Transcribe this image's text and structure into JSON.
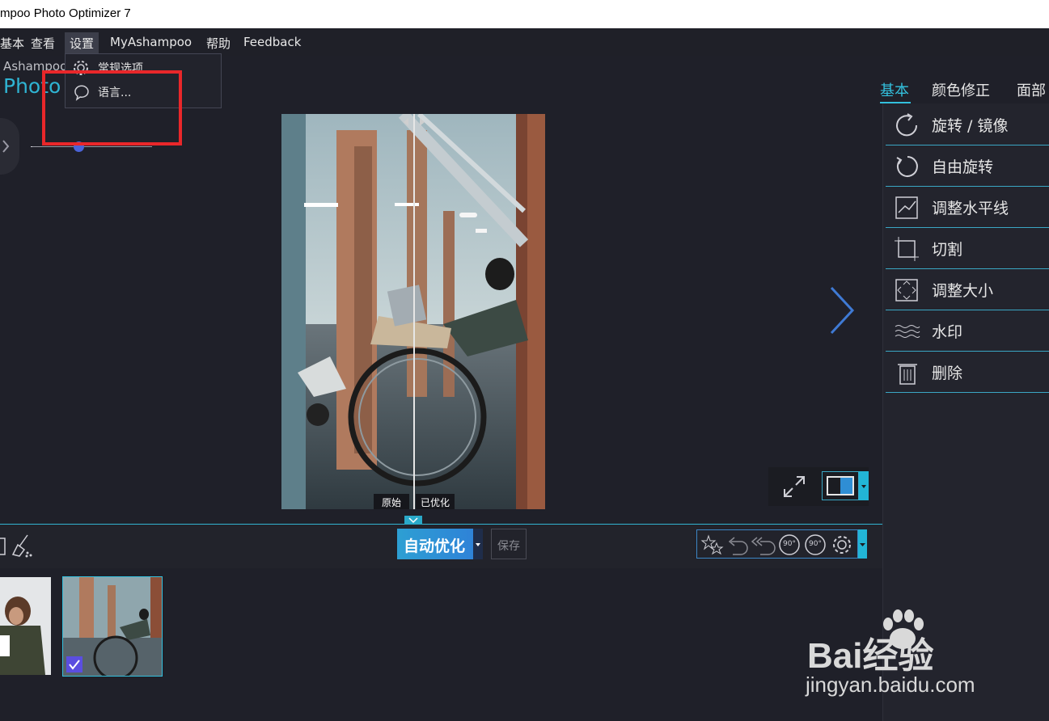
{
  "window": {
    "title": "mpoo Photo Optimizer 7"
  },
  "menu": [
    {
      "label": "基本"
    },
    {
      "label": "查看"
    },
    {
      "label": "设置"
    },
    {
      "label": "MyAshampoo"
    },
    {
      "label": "帮助"
    },
    {
      "label": "Feedback"
    }
  ],
  "settings_menu": {
    "items": [
      {
        "label": "常规选项",
        "icon": "gear-icon"
      },
      {
        "label": "语言...",
        "icon": "speech-bubble-icon"
      }
    ]
  },
  "logo": {
    "small": "Ashampoo",
    "big": "Photo"
  },
  "right_tabs": [
    {
      "label": "基本",
      "active": true
    },
    {
      "label": "颜色修正",
      "active": false
    },
    {
      "label": "面部",
      "active": false
    }
  ],
  "tools": [
    {
      "label": "旋转 / 镜像",
      "icon": "rotate-mirror-icon"
    },
    {
      "label": "自由旋转",
      "icon": "free-rotate-icon"
    },
    {
      "label": "调整水平线",
      "icon": "horizon-icon"
    },
    {
      "label": "切割",
      "icon": "crop-icon"
    },
    {
      "label": "调整大小",
      "icon": "resize-icon"
    },
    {
      "label": "水印",
      "icon": "watermark-icon"
    },
    {
      "label": "删除",
      "icon": "trash-icon"
    }
  ],
  "compare": {
    "original": "原始",
    "optimized": "已优化"
  },
  "bottom": {
    "auto_optimize": "自动优化",
    "save": "保存",
    "rotate_left_90": "90°",
    "rotate_right_90": "90°"
  },
  "watermark": {
    "brand": "Bai经验",
    "url": "jingyan.baidu.com"
  },
  "colors": {
    "accent": "#33c0dd",
    "highlight": "#e9272a",
    "background": "#1f2029"
  }
}
